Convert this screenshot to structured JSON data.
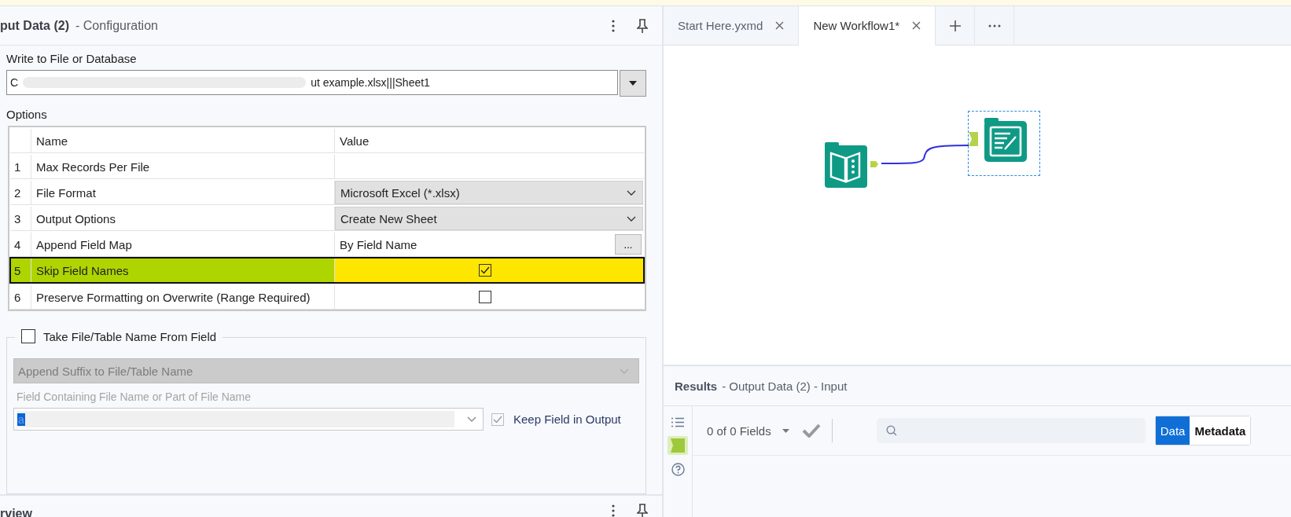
{
  "config_panel": {
    "title": "put Data (2)",
    "subtitle": "- Configuration",
    "destination": {
      "label": "Write to File or Database",
      "value_start": "C",
      "value_end": "ut example.xlsx|||Sheet1"
    },
    "options": {
      "label": "Options",
      "columns": [
        "Name",
        "Value"
      ],
      "rows": [
        {
          "number": "1",
          "name": "Max Records Per File",
          "kind": "text",
          "selected": false
        },
        {
          "number": "2",
          "name": "File Format",
          "kind": "dropdown",
          "value": "Microsoft Excel (*.xlsx)",
          "selected": false
        },
        {
          "number": "3",
          "name": "Output Options",
          "kind": "dropdown",
          "value": "Create New Sheet",
          "selected": false
        },
        {
          "number": "4",
          "name": "Append Field Map",
          "kind": "text_button",
          "value": "By Field Name",
          "button": "...",
          "selected": false
        },
        {
          "number": "5",
          "name": "Skip Field Names",
          "kind": "checkbox",
          "checked": true,
          "selected": true,
          "highlighted": true
        },
        {
          "number": "6",
          "name": "Preserve Formatting on Overwrite (Range Required)",
          "kind": "checkbox",
          "checked": false,
          "selected": false
        }
      ]
    },
    "field_name_group": {
      "label": "Take File/Table Name From Field",
      "checked": false,
      "mode": {
        "value": "Append Suffix to File/Table Name",
        "disabled": true
      },
      "field_label": "Field Containing File Name or Part of File Name",
      "field": {
        "value": "a"
      },
      "keep_field": {
        "label": "Keep Field in Output",
        "checked": true,
        "disabled": true
      }
    }
  },
  "overview_panel": {
    "title": "rview"
  },
  "workflow": {
    "tabs": [
      {
        "label": "Start Here.yxmd",
        "selected": false
      },
      {
        "label": "New Workflow1*",
        "selected": true
      }
    ],
    "tools": [
      {
        "kind": "input",
        "selected": false
      },
      {
        "kind": "output",
        "selected": true
      }
    ]
  },
  "results": {
    "title": "Results",
    "subtitle": "- Output Data (2) - Input",
    "side_tools": [
      {
        "kind": "list",
        "selected": false
      },
      {
        "kind": "tag",
        "selected": true
      },
      {
        "kind": "help",
        "selected": false
      }
    ],
    "fields_count": "0 of 0 Fields",
    "views": [
      {
        "label": "Data",
        "selected": true
      },
      {
        "label": "Metadata",
        "selected": false
      }
    ]
  }
}
